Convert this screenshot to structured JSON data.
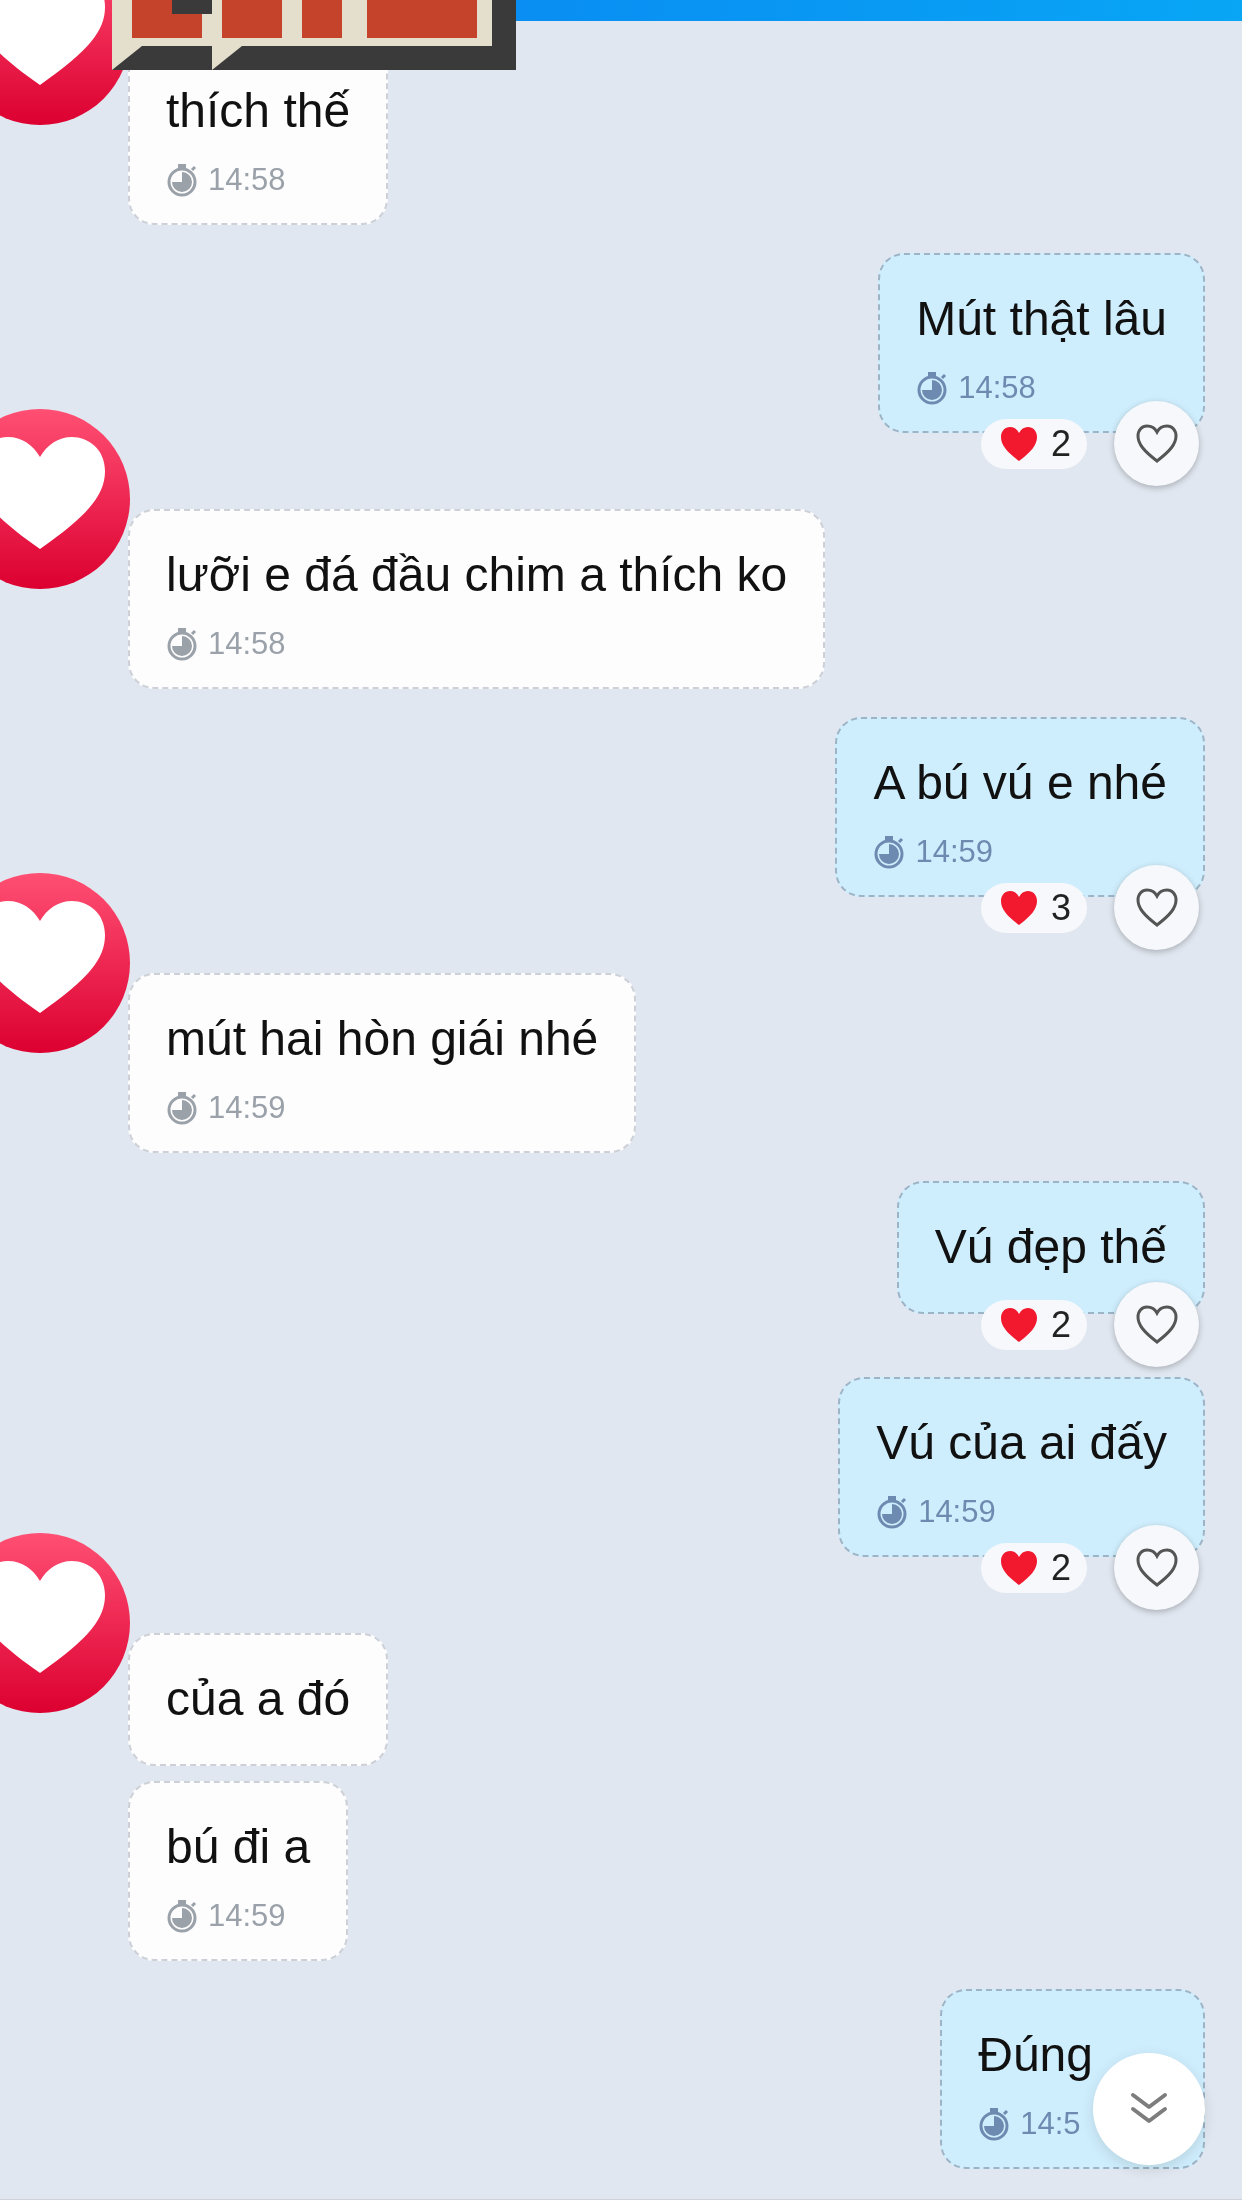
{
  "messages": [
    {
      "kind": "incoming",
      "avatar": true,
      "text": "thích thế",
      "time": "14:58"
    },
    {
      "kind": "outgoing",
      "text": "Mút thật lâu",
      "time": "14:58",
      "reaction": {
        "count": "2"
      }
    },
    {
      "kind": "incoming",
      "avatar": true,
      "text": "lưỡi e đá đầu chim a thích ko",
      "time": "14:58"
    },
    {
      "kind": "outgoing",
      "text": "A bú vú e nhé",
      "time": "14:59",
      "reaction": {
        "count": "3"
      }
    },
    {
      "kind": "incoming",
      "avatar": true,
      "text": "mút hai hòn giái nhé",
      "time": "14:59"
    },
    {
      "kind": "outgoing",
      "text": "Vú đẹp thế",
      "reaction": {
        "count": "2"
      }
    },
    {
      "kind": "outgoing",
      "text": "Vú của ai đấy",
      "time": "14:59",
      "reaction": {
        "count": "2"
      }
    },
    {
      "kind": "incoming",
      "avatar": true,
      "text": "của a đó"
    },
    {
      "kind": "incoming",
      "avatar": false,
      "text": "bú đi a",
      "time": "14:59"
    },
    {
      "kind": "outgoing",
      "text": "Đúng",
      "time": "14:5",
      "covered": true
    }
  ]
}
